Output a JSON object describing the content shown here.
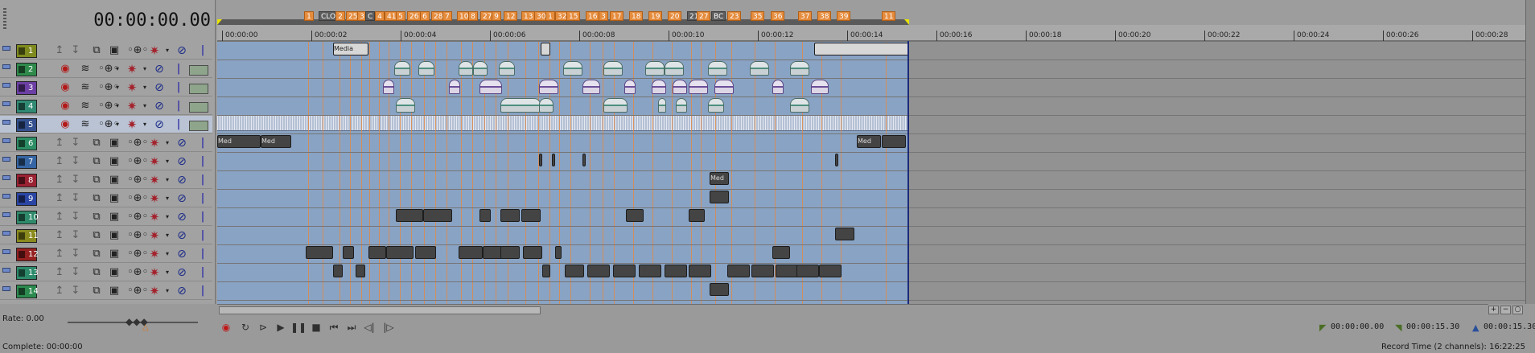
{
  "timecode": "00:00:00.00",
  "ruler": {
    "time_labels": [
      "00:00:00",
      "00:00:02",
      "00:00:04",
      "00:00:06",
      "00:00:08",
      "00:00:10",
      "00:00:12",
      "00:00:14",
      "00:00:16",
      "00:00:18",
      "00:00:20",
      "00:00:22",
      "00:00:24",
      "00:00:26",
      "00:00:28"
    ],
    "markers": [
      "1",
      "CLOC",
      "2",
      "25",
      "3",
      "C",
      "4",
      "41",
      "5",
      "26",
      "6",
      "28",
      "7",
      "10",
      "8",
      "27",
      "9",
      "12",
      "13",
      "30",
      "1",
      "32",
      "15",
      "16",
      "3",
      "17",
      "18",
      "19",
      "20",
      "21",
      "27",
      "BC",
      "23",
      "35",
      "36",
      "37",
      "38",
      "39",
      "11"
    ]
  },
  "tracks": [
    {
      "num": "1",
      "color": "#7f8a1e",
      "type": "video"
    },
    {
      "num": "2",
      "color": "#2f8a4c",
      "type": "audio"
    },
    {
      "num": "3",
      "color": "#6b3fa3",
      "type": "audio"
    },
    {
      "num": "4",
      "color": "#318a74",
      "type": "audio"
    },
    {
      "num": "5",
      "color": "#34508e",
      "type": "audio"
    },
    {
      "num": "6",
      "color": "#2c8e65",
      "type": "video"
    },
    {
      "num": "7",
      "color": "#3565a3",
      "type": "video"
    },
    {
      "num": "8",
      "color": "#9b2233",
      "type": "video"
    },
    {
      "num": "9",
      "color": "#2a45a3",
      "type": "video"
    },
    {
      "num": "10",
      "color": "#2f8a6b",
      "type": "video"
    },
    {
      "num": "11",
      "color": "#8a8a1e",
      "type": "video"
    },
    {
      "num": "12",
      "color": "#952020",
      "type": "video"
    },
    {
      "num": "13",
      "color": "#2c8a6b",
      "type": "video"
    },
    {
      "num": "14",
      "color": "#2c8a4e",
      "type": "video"
    }
  ],
  "event_labels": {
    "media": "Media",
    "med": "Med"
  },
  "transport": {
    "rate_label": "Rate: 0.00",
    "complete_label": "Complete: 00:00:00",
    "selection_start": "00:00:00.00",
    "selection_end": "00:00:15.30",
    "selection_length": "00:00:15.30",
    "record_time": "Record Time (2 channels): 16:22:25"
  },
  "colors": {
    "marker": "#e58c3d",
    "loop": "#e8e400",
    "project_area": "#89a3c4"
  }
}
